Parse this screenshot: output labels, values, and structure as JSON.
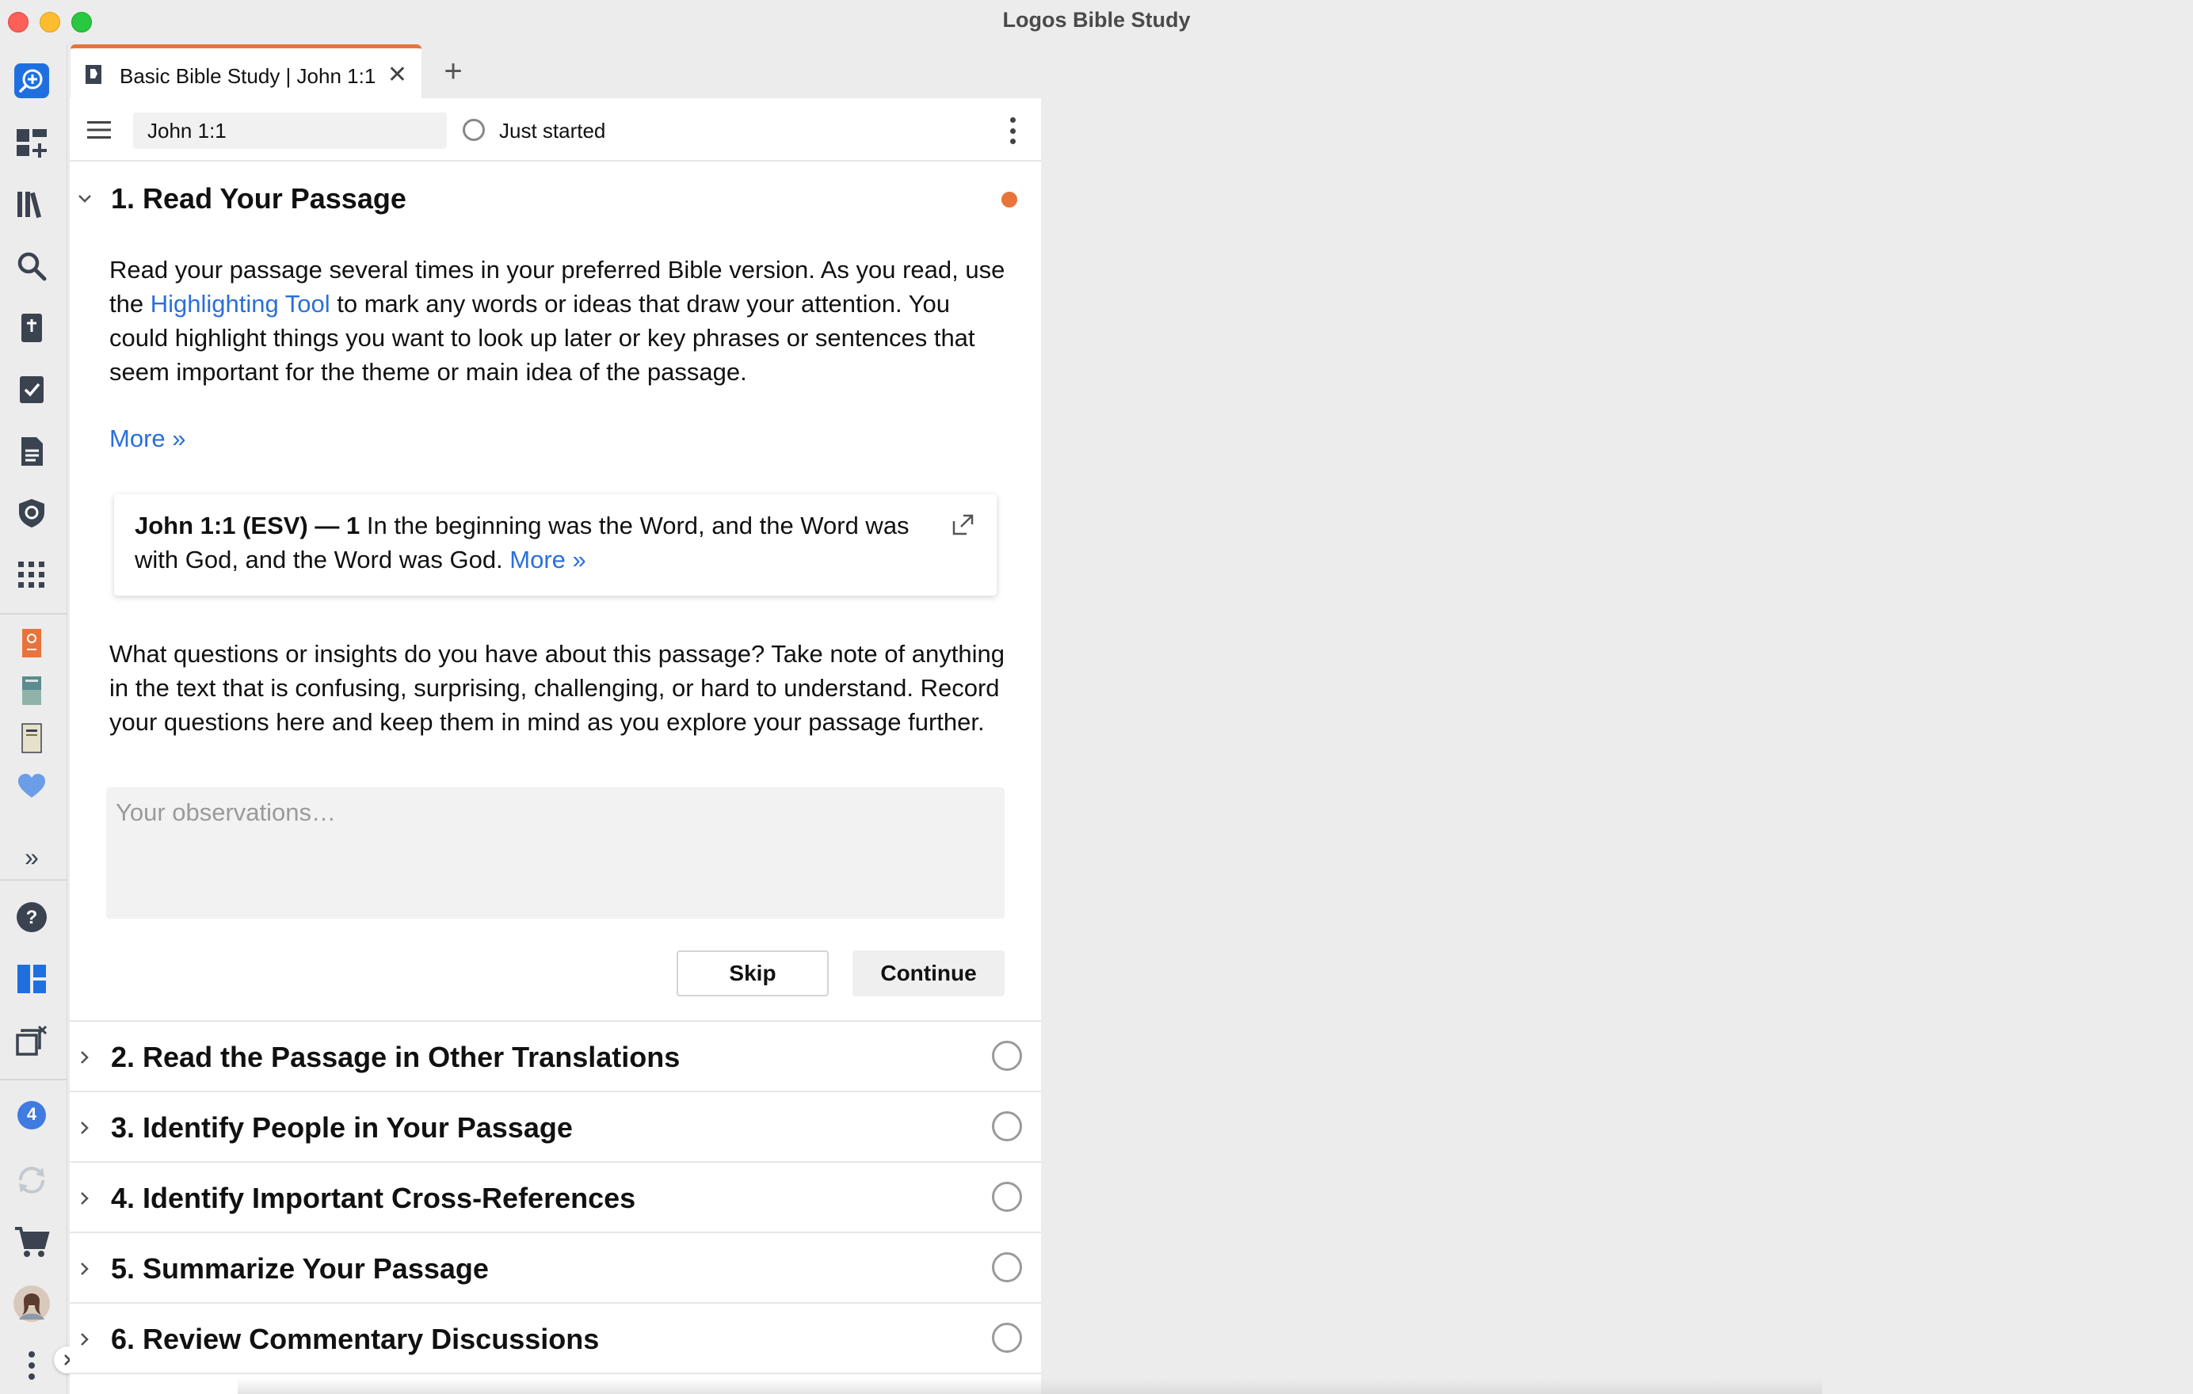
{
  "window": {
    "title": "Logos Bible Study"
  },
  "tabs": [
    {
      "label": "Basic Bible Study | John 1:1",
      "close": "✕"
    }
  ],
  "new_tab": "+",
  "toolbar": {
    "reference_value": "John 1:1",
    "status_label": "Just started"
  },
  "sidebar": {
    "expand": "»",
    "badge_count": "4"
  },
  "step1": {
    "title": "1. Read Your Passage",
    "intro_before": "Read your passage several times in your preferred Bible version. As you read, use the ",
    "intro_link": "Highlighting Tool",
    "intro_after": " to mark any words or ideas that draw your attention. You could highlight things you want to look up later or key phrases or sentences that seem important for the theme or main idea of the passage.",
    "more": "More »",
    "verse": {
      "ref": "John 1:1 (ESV) — 1",
      "text": " In the beginning was the Word, and the Word was with God, and the Word was God. ",
      "more": "More »"
    },
    "question": "What questions or insights do you have about this passage? Take note of anything in the text that is confusing, surprising, challenging, or hard to understand. Record your questions here and keep them in mind as you explore your passage further.",
    "observations_placeholder": "Your observations…",
    "skip": "Skip",
    "continue": "Continue"
  },
  "steps": [
    {
      "title": "2. Read the Passage in Other Translations"
    },
    {
      "title": "3. Identify People in Your Passage"
    },
    {
      "title": "4. Identify Important Cross-References"
    },
    {
      "title": "5. Summarize Your Passage"
    },
    {
      "title": "6. Review Commentary Discussions"
    }
  ],
  "colors": {
    "accent": "#e8743b",
    "link": "#2a6fdb",
    "sidebar_active": "#1f6fe0"
  }
}
